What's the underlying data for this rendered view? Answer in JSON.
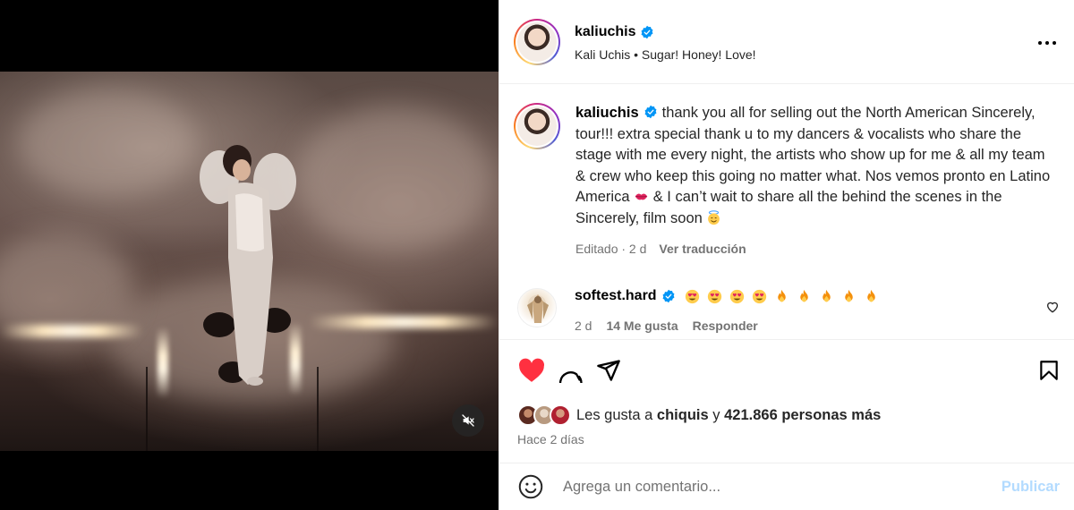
{
  "post": {
    "username": "kaliuchis",
    "subtitle": "Kali Uchis • Sugar! Honey! Love!",
    "caption_part1": "thank you all for selling out the North American Sincerely, tour!!! extra special thank u to my dancers & vocalists who share the stage with me every night, the artists who show up for me & all my team & crew who keep this going no matter what. Nos vemos pronto en Latino America",
    "caption_part2": "& I can’t wait to share all the behind the scenes in the Sincerely, film soon",
    "edited": "Editado · 2 d",
    "see_translation": "Ver traducción"
  },
  "comment": {
    "username": "softest.hard",
    "time": "2 d",
    "likes": "14 Me gusta",
    "reply": "Responder"
  },
  "likes": {
    "prefix": "Les gusta a",
    "liker": "chiquis",
    "connector": "y",
    "others": "421.866 personas más",
    "date": "Hace 2 días"
  },
  "composer": {
    "placeholder": "Agrega un comentario...",
    "publish": "Publicar"
  },
  "icons": {
    "verified": "verified-badge-icon",
    "like": "heart-filled-icon",
    "comment": "comment-bubble-icon",
    "share": "paper-plane-icon",
    "save": "bookmark-icon",
    "mute": "speaker-muted-icon",
    "emoji": "smiley-icon",
    "more": "more-options-icon"
  },
  "colors": {
    "like_red": "#ff3040",
    "verified_blue": "#0095f6",
    "publish_disabled": "#b3dbff"
  }
}
